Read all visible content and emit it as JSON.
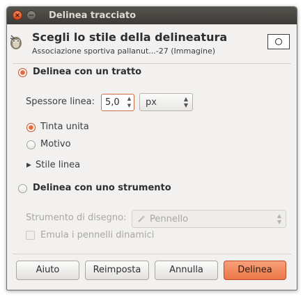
{
  "window": {
    "title": "Delinea tracciato",
    "close_glyph": "×",
    "minimize_glyph": "−"
  },
  "header": {
    "title": "Scegli lo stile della delineatura",
    "subtitle": "Associazione sportiva pallanut...-27 (Immagine)",
    "icon": "gimp-icon"
  },
  "stroke_line": {
    "label": "Delinea con un tratto",
    "selected": true,
    "line_width_label": "Spessore linea:",
    "line_width_value": "5,0",
    "unit": "px",
    "fill_options": [
      {
        "label": "Tinta unita",
        "selected": true
      },
      {
        "label": "Motivo",
        "selected": false
      }
    ],
    "line_style_label": "Stile linea"
  },
  "stroke_tool": {
    "label": "Delinea con uno strumento",
    "selected": false,
    "paint_tool_label": "Strumento di disegno:",
    "paint_tool_value": "Pennello",
    "emulate_label": "Emula i pennelli dinamici"
  },
  "buttons": {
    "help": "Aiuto",
    "reset": "Reimposta",
    "cancel": "Annulla",
    "stroke": "Delinea"
  },
  "colors": {
    "accent": "#ec7748",
    "titlebar": "#3c3b37",
    "background": "#f2f1f0"
  }
}
